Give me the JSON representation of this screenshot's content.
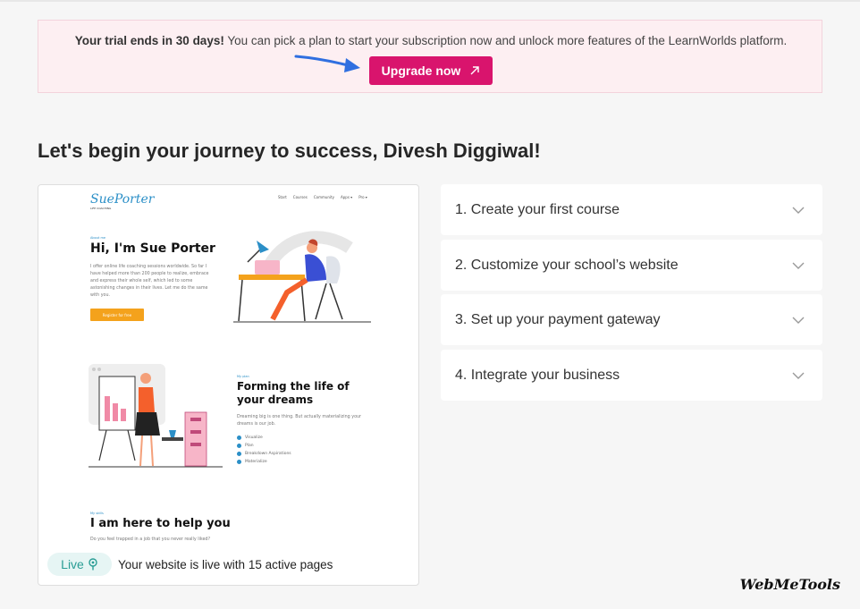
{
  "banner": {
    "bold": "Your trial ends in 30 days!",
    "text": " You can pick a plan to start your subscription now and unlock more features of the LearnWorlds platform.",
    "button": "Upgrade now",
    "button_icon": "arrow-up-right-icon",
    "accent": "#d9146d",
    "background": "#fdeff2"
  },
  "heading": "Let's begin your journey to success, Divesh Diggiwal!",
  "preview": {
    "site": {
      "logo": "SuePorter",
      "logo_sub": "LIFE COACHING",
      "nav": [
        "Start",
        "Courses",
        "Community",
        "Apps ▾",
        "Pro ▾"
      ],
      "hero_kicker": "About me",
      "hero_title": "Hi, I'm Sue Porter",
      "hero_text": "I offer online life coaching sessions worldwide. So far I have helped more than 200 people to realize, embrace and express their whole self, which led to some astonishing changes in their lives. Let me do the same with you.",
      "hero_button": "Register for free",
      "plan_kicker": "My plan",
      "plan_title": "Forming the life of your dreams",
      "plan_text": "Dreaming big is one thing. But actually materializing your dreams is our job.",
      "plan_items": [
        "Visualize",
        "Plan",
        "Breakdown Aspirations",
        "Materialize"
      ],
      "help_kicker": "My skills",
      "help_title": "I am here to help you",
      "help_text": "Do you feel trapped in a job that you never really liked?"
    },
    "live_badge": "Live",
    "live_icon": "location-pin-icon",
    "status": "Your website is live with 15 active pages"
  },
  "steps": [
    {
      "label": "1. Create your first course"
    },
    {
      "label": "2. Customize your school’s website"
    },
    {
      "label": "3. Set up your payment gateway"
    },
    {
      "label": "4. Integrate your business"
    }
  ],
  "step_icon": "chevron-down-icon",
  "watermark": "WebMeTools"
}
